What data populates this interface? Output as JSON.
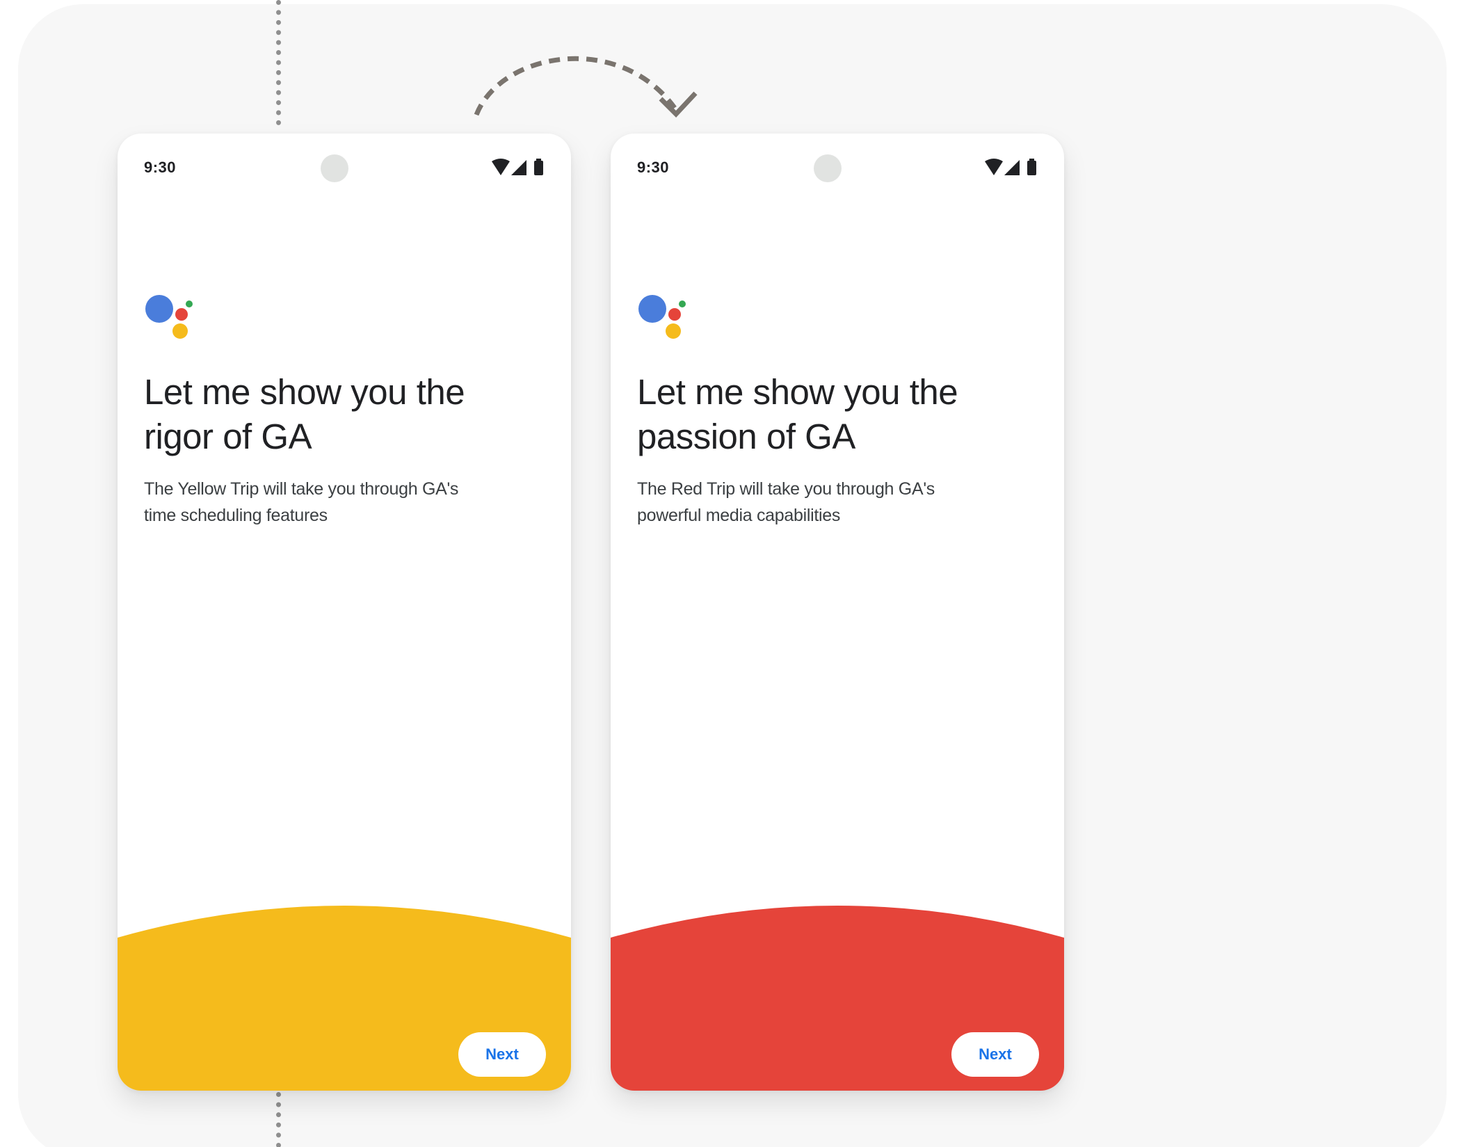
{
  "colors": {
    "background": "#f7f7f7",
    "yellow_trip": "#f5bb1c",
    "red_trip": "#e5443a",
    "button_text": "#1a73e8",
    "assistant_blue": "#4a7ddb",
    "assistant_red": "#e5443a",
    "assistant_yellow": "#f5bb1c",
    "assistant_green": "#34a853"
  },
  "screens": [
    {
      "status": {
        "time": "9:30",
        "icons": [
          "wifi-icon",
          "signal-icon",
          "battery-icon"
        ]
      },
      "logo": "google-assistant-logo",
      "headline_line1": "Let me show you the",
      "headline_line2": "rigor of GA",
      "subtext_line1": "The Yellow Trip will take you through GA's",
      "subtext_line2": "time scheduling features",
      "accent_color": "#f5bb1c",
      "next_label": "Next"
    },
    {
      "status": {
        "time": "9:30",
        "icons": [
          "wifi-icon",
          "signal-icon",
          "battery-icon"
        ]
      },
      "logo": "google-assistant-logo",
      "headline_line1": "Let me show you the",
      "headline_line2": "passion of GA",
      "subtext_line1": "The Red Trip will take you through GA's",
      "subtext_line2": "powerful media capabilities",
      "accent_color": "#e5443a",
      "next_label": "Next"
    }
  ]
}
